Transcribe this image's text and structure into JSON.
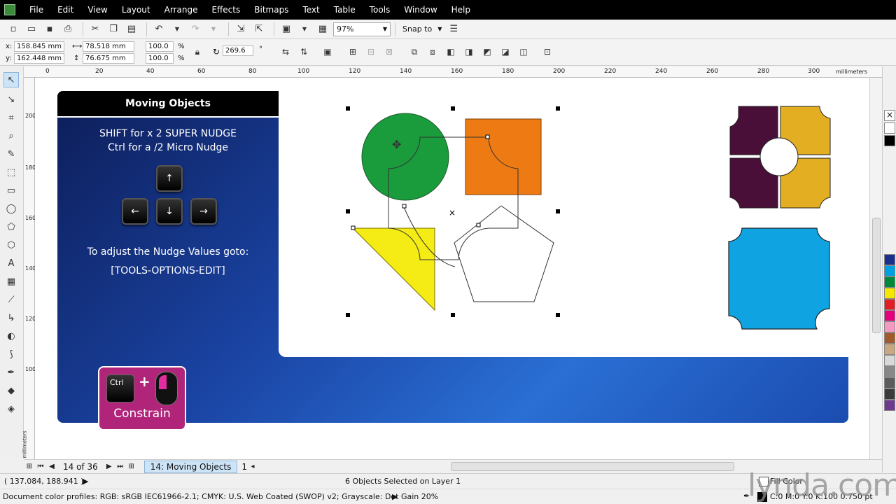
{
  "menu": [
    "File",
    "Edit",
    "View",
    "Layout",
    "Arrange",
    "Effects",
    "Bitmaps",
    "Text",
    "Table",
    "Tools",
    "Window",
    "Help"
  ],
  "toolbar": {
    "zoom": "97%",
    "snap_to": "Snap to"
  },
  "propbar": {
    "x_label": "x:",
    "x_value": "158.845 mm",
    "y_label": "y:",
    "y_value": "162.448 mm",
    "width_value": "78.518 mm",
    "height_value": "76.675 mm",
    "scale_x": "100.0",
    "scale_y": "100.0",
    "percent": "%",
    "rotation": "269.6",
    "degree": "°"
  },
  "ruler": {
    "h_labels": [
      "0",
      "20",
      "40",
      "60",
      "80",
      "100",
      "120",
      "140",
      "160",
      "180",
      "200",
      "220",
      "240",
      "260",
      "280",
      "300"
    ],
    "h_unit": "millimeters",
    "v_labels": [
      "200",
      "180",
      "160",
      "140",
      "120",
      "100"
    ],
    "v_unit": "millimeters"
  },
  "slide": {
    "title": "Moving Objects",
    "line1": "SHIFT for  x 2   SUPER NUDGE",
    "line2": "Ctrl for a /2 Micro Nudge",
    "line3": "To adjust the Nudge Values goto:",
    "line4": "[TOOLS-OPTIONS-EDIT]",
    "key_up": "↑",
    "key_left": "←",
    "key_down": "↓",
    "key_right": "→",
    "ctrl_key": "Ctrl",
    "plus": "+",
    "constrain": "Constrain"
  },
  "colors": {
    "circle": "#1a9b3c",
    "square": "#ee7a14",
    "triangle": "#f4ec14",
    "dark_purple": "#4a0f38",
    "mustard": "#e3ae22",
    "cyan": "#0fa3e2"
  },
  "pagebar": {
    "page_count": "14 of 36",
    "page_tab": "14: Moving Objects",
    "next_tab": "1"
  },
  "status": {
    "coords": "( 137.084, 188.941 )",
    "selection": "6 Objects Selected on Layer 1",
    "profile": "Document color profiles: RGB: sRGB IEC61966-2.1; CMYK: U.S. Web Coated (SWOP) v2; Grayscale: Dot Gain 20%",
    "fill": "Fill Color",
    "outline": "C:0 M:0 Y:0 K:100  0.750 pt"
  },
  "watermark": "lynda.com",
  "palette": [
    "#ffffff",
    "#000000",
    "#1d2f8a",
    "#00a0e4",
    "#00883b",
    "#f6e700",
    "#e31d24",
    "#e4007d",
    "#f49ac1",
    "#a05a2c",
    "#c8a882",
    "#d9d9d9",
    "#888888",
    "#5c5c5c",
    "#3b3b3b",
    "#6d3a8f"
  ]
}
